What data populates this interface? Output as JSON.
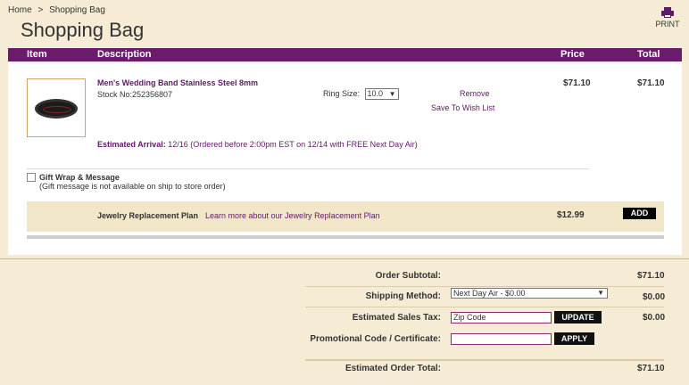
{
  "breadcrumb": {
    "home": "Home",
    "sep": ">",
    "current": "Shopping Bag"
  },
  "page_title": "Shopping Bag",
  "print_label": "PRINT",
  "table_headers": {
    "item": "Item",
    "description": "Description",
    "price": "Price",
    "total": "Total"
  },
  "product": {
    "name": "Men's Wedding Band Stainless Steel 8mm",
    "stock": "Stock No:252356807",
    "ring_size_label": "Ring Size:",
    "ring_size_value": "10.0",
    "remove_label": "Remove",
    "wishlist_label": "Save To Wish List",
    "price": "$71.10",
    "total": "$71.10",
    "arrival_label": "Estimated Arrival:",
    "arrival_text": "12/16 (Ordered before 2:00pm EST on 12/14 with FREE Next Day Air)"
  },
  "gift": {
    "title": "Gift Wrap & Message",
    "note": "(Gift message is not available on ship to store order)",
    "checked": false
  },
  "replacement_plan": {
    "label": "Jewelry Replacement Plan",
    "link": "Learn more about our Jewelry Replacement Plan",
    "price": "$12.99",
    "button": "ADD"
  },
  "summary": {
    "subtotal_label": "Order Subtotal:",
    "subtotal_value": "$71.10",
    "shipping_label": "Shipping Method:",
    "shipping_option": "Next Day Air - $0.00",
    "shipping_value": "$0.00",
    "tax_label": "Estimated Sales Tax:",
    "zip_placeholder": "Zip Code",
    "update_button": "UPDATE",
    "tax_value": "$0.00",
    "promo_label": "Promotional Code / Certificate:",
    "apply_button": "APPLY",
    "total_label": "Estimated Order Total:",
    "total_value": "$71.10"
  },
  "colors": {
    "brand": "#6a1b6a",
    "background": "#f6ecd5"
  }
}
